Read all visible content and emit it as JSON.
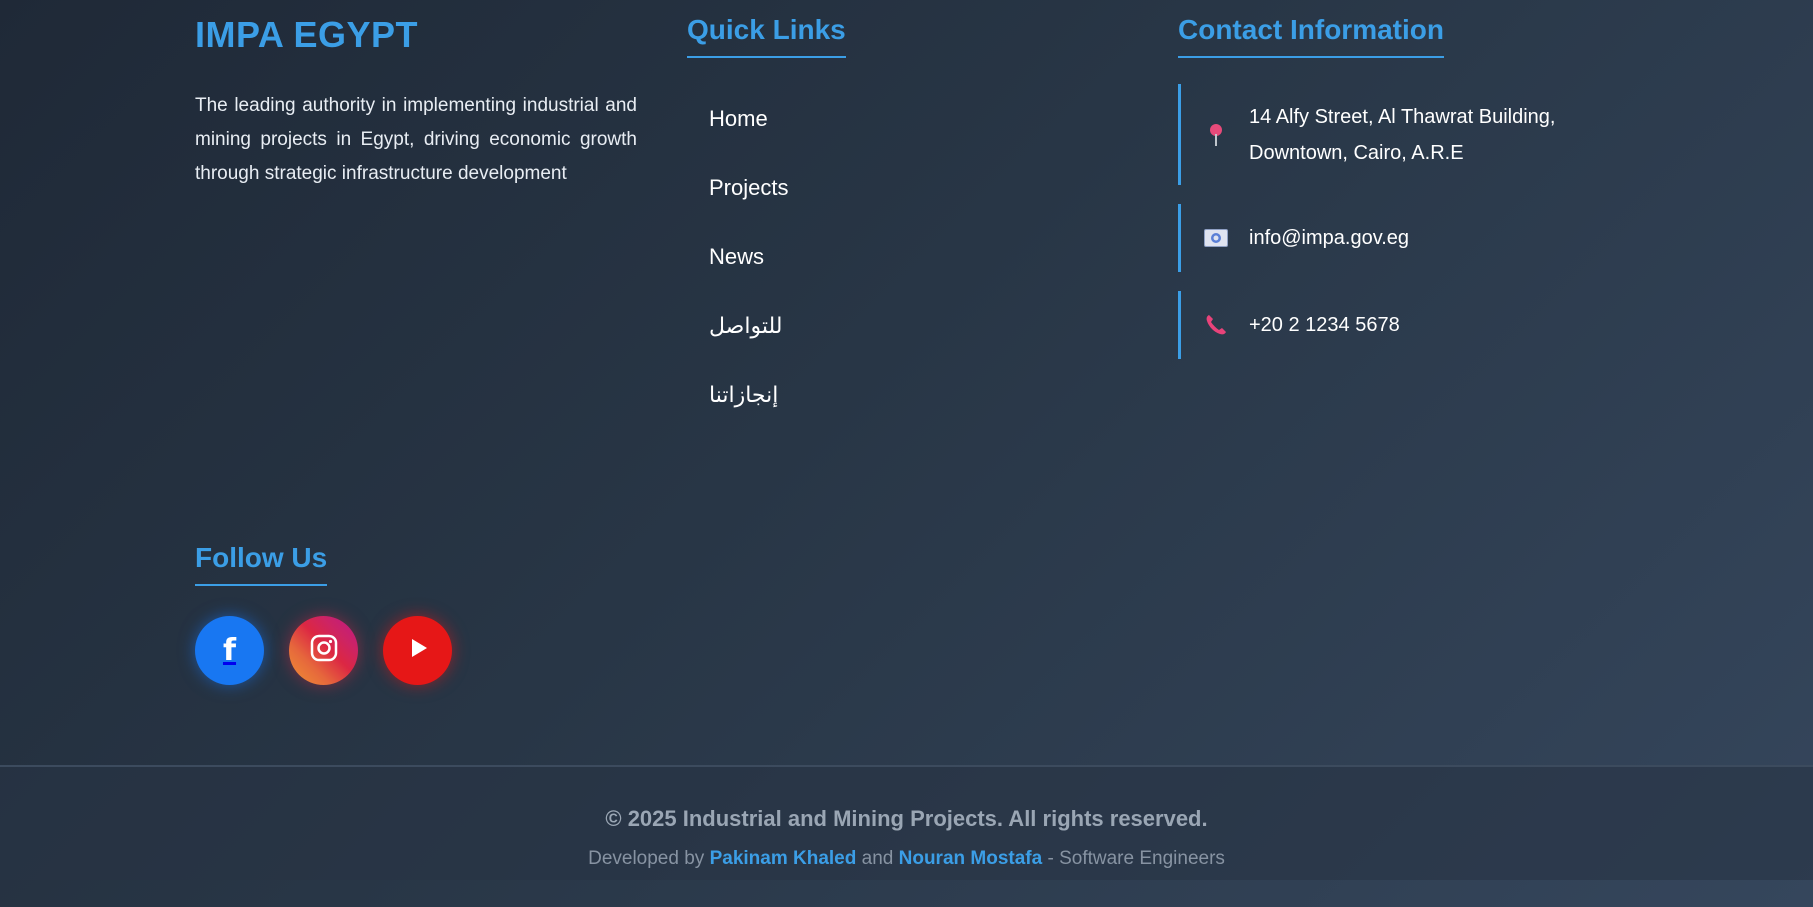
{
  "brand": {
    "title": "IMPA EGYPT",
    "description": "The leading authority in implementing industrial and mining projects in Egypt, driving economic growth through strategic infrastructure development"
  },
  "quick_links": {
    "heading": "Quick Links",
    "items": [
      {
        "label": "Home"
      },
      {
        "label": "Projects"
      },
      {
        "label": "News"
      },
      {
        "label": "للتواصل"
      },
      {
        "label": "إنجازاتنا"
      }
    ]
  },
  "contact": {
    "heading": "Contact Information",
    "address_line1": "14 Alfy Street, Al Thawrat Building,",
    "address_line2": "Downtown, Cairo, A.R.E",
    "email": "info@impa.gov.eg",
    "phone": "+20 2 1234 5678",
    "icons": [
      "pin-icon",
      "email-icon",
      "phone-icon"
    ]
  },
  "follow": {
    "heading": "Follow Us",
    "socials": [
      {
        "name": "facebook-icon",
        "color": "#1877f2"
      },
      {
        "name": "instagram-icon",
        "color": "#dc2743"
      },
      {
        "name": "youtube-icon",
        "color": "#e61717"
      }
    ]
  },
  "footer_bottom": {
    "copyright": "© 2025 Industrial and Mining Projects. All rights reserved.",
    "developed_by": "Developed by",
    "developer1": "Pakinam Khaled",
    "and": "and",
    "developer2": "Nouran Mostafa",
    "role": "- Software Engineers"
  },
  "colors": {
    "accent": "#3b9ee6",
    "background_start": "#1f2937",
    "background_end": "#35465c"
  }
}
